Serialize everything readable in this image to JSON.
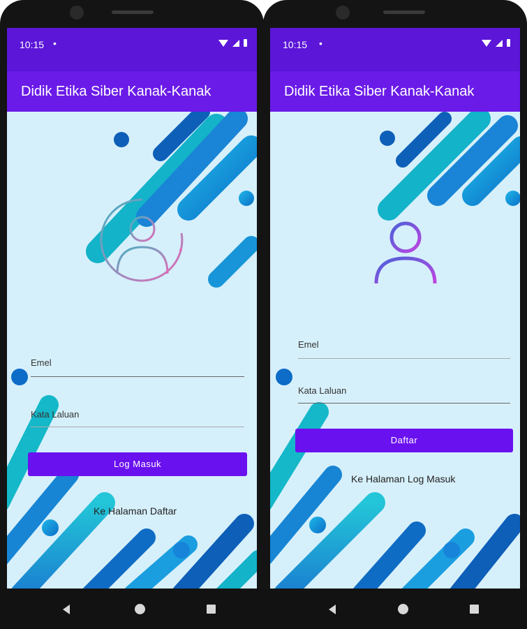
{
  "status_bar": {
    "time": "10:15",
    "dot": "•"
  },
  "app_bar": {
    "title": "Didik Etika Siber Kanak-Kanak"
  },
  "login_screen": {
    "email_label": "Emel",
    "password_label": "Kata Laluan",
    "login_button": "Log Masuk",
    "link": "Ke Halaman Daftar"
  },
  "register_screen": {
    "email_label": "Emel",
    "password_label": "Kata Laluan",
    "register_button": "Daftar",
    "link": "Ke Halaman Log Masuk"
  },
  "colors": {
    "status_bar": "#5b16d8",
    "app_bar": "#6a1be8",
    "button": "#6a11f0",
    "background": "#d6f0fb"
  },
  "icons": [
    "wifi-icon",
    "signal-icon",
    "battery-icon",
    "user-avatar-icon",
    "nav-back-icon",
    "nav-home-icon",
    "nav-recent-icon"
  ]
}
